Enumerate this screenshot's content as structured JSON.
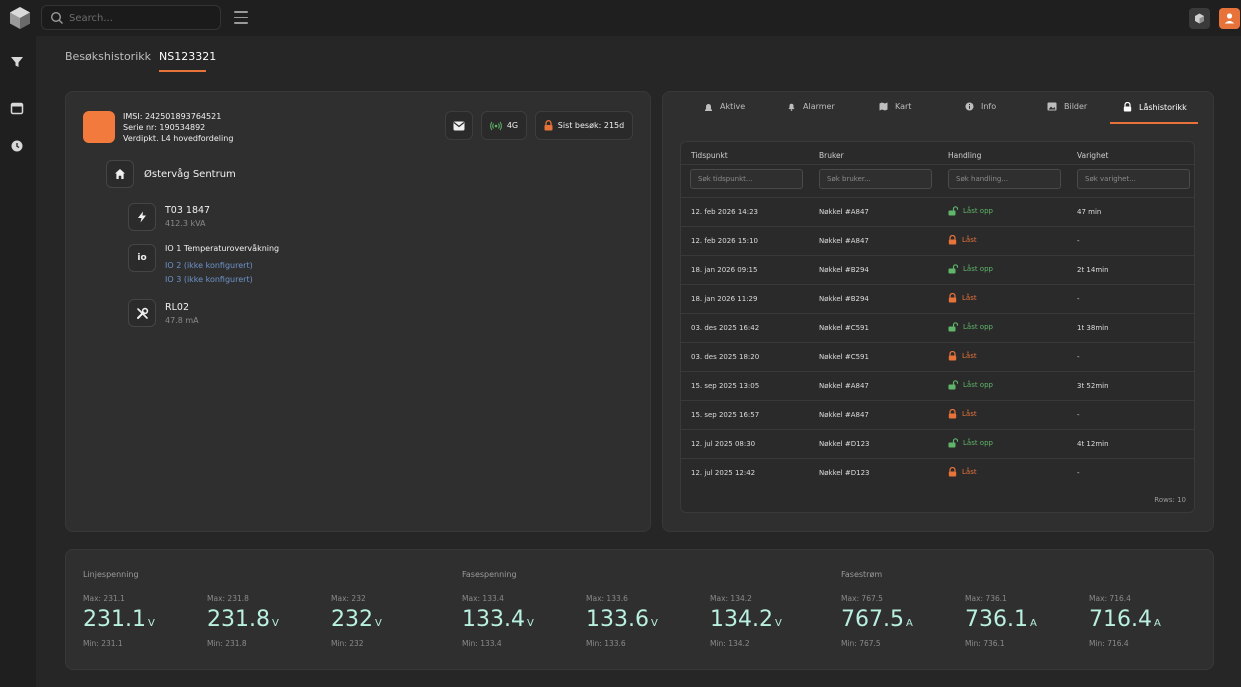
{
  "topbar": {
    "search_placeholder": "Search...",
    "logo_icon": "cube-logo-icon",
    "right_buttons": [
      "cube-icon",
      "user-icon"
    ]
  },
  "rail": {
    "icons": [
      "filter-icon",
      "calendar-icon",
      "clock-icon"
    ]
  },
  "tabs": [
    {
      "label": "Besøkshistorikk",
      "active": false
    },
    {
      "label": "NS123321",
      "active": true
    }
  ],
  "device": {
    "imsi": "IMSI: 242501893764521",
    "serial": "Serie nr: 190534892",
    "verdipkt": "Verdipkt. L4 hovedfordeling",
    "network": "4G",
    "last_visit": "Sist besøk: 215d",
    "location": "Østervåg Sentrum",
    "items": [
      {
        "title": "T03 1847",
        "sub": "412.3 kVA",
        "icon": "bolt-icon"
      },
      {
        "title": "IO 1 Temperaturovervåkning",
        "links": [
          "IO 2 (ikke konfigurert)",
          "IO 3 (ikke konfigurert)"
        ],
        "icon": "io"
      },
      {
        "title": "RL02",
        "sub": "47.8 mA",
        "icon": "tools-icon"
      }
    ]
  },
  "right_tabs": [
    {
      "label": "Aktive",
      "icon": "siren-icon",
      "active": false
    },
    {
      "label": "Alarmer",
      "icon": "bell-icon",
      "active": false
    },
    {
      "label": "Kart",
      "icon": "map-icon",
      "active": false
    },
    {
      "label": "Info",
      "icon": "info-icon",
      "active": false
    },
    {
      "label": "Bilder",
      "icon": "image-icon",
      "active": false
    },
    {
      "label": "Låshistorikk",
      "icon": "lock-icon",
      "active": true
    }
  ],
  "lock_table": {
    "headers": [
      "Tidspunkt",
      "Bruker",
      "Handling",
      "Varighet"
    ],
    "filters": [
      "Søk tidspunkt...",
      "Søk bruker...",
      "Søk handling...",
      "Søk varighet..."
    ],
    "rows": [
      {
        "time": "12. feb 2026 14:23",
        "user": "Nøkkel #A847",
        "action": "Låst opp",
        "state": "open",
        "duration": "47 min"
      },
      {
        "time": "12. feb 2026 15:10",
        "user": "Nøkkel #A847",
        "action": "Låst",
        "state": "locked",
        "duration": "-"
      },
      {
        "time": "18. jan 2026 09:15",
        "user": "Nøkkel #B294",
        "action": "Låst opp",
        "state": "open",
        "duration": "2t 14min"
      },
      {
        "time": "18. jan 2026 11:29",
        "user": "Nøkkel #B294",
        "action": "Låst",
        "state": "locked",
        "duration": "-"
      },
      {
        "time": "03. des 2025 16:42",
        "user": "Nøkkel #C591",
        "action": "Låst opp",
        "state": "open",
        "duration": "1t 38min"
      },
      {
        "time": "03. des 2025 18:20",
        "user": "Nøkkel #C591",
        "action": "Låst",
        "state": "locked",
        "duration": "-"
      },
      {
        "time": "15. sep 2025 13:05",
        "user": "Nøkkel #A847",
        "action": "Låst opp",
        "state": "open",
        "duration": "3t 52min"
      },
      {
        "time": "15. sep 2025 16:57",
        "user": "Nøkkel #A847",
        "action": "Låst",
        "state": "locked",
        "duration": "-"
      },
      {
        "time": "12. jul 2025 08:30",
        "user": "Nøkkel #D123",
        "action": "Låst opp",
        "state": "open",
        "duration": "4t 12min"
      },
      {
        "time": "12. jul 2025 12:42",
        "user": "Nøkkel #D123",
        "action": "Låst",
        "state": "locked",
        "duration": "-"
      }
    ],
    "footer": "Rows: 10"
  },
  "metrics": {
    "groups": [
      {
        "label": "Linjespenning"
      },
      {
        "label": "Fasespenning"
      },
      {
        "label": "Fasestrøm"
      }
    ],
    "values": [
      {
        "max": "Max: 231.1",
        "value": "231.1",
        "unit": "V",
        "min": "Min: 231.1"
      },
      {
        "max": "Max: 231.8",
        "value": "231.8",
        "unit": "V",
        "min": "Min: 231.8"
      },
      {
        "max": "Max: 232",
        "value": "232",
        "unit": "V",
        "min": "Min: 232"
      },
      {
        "max": "Max: 133.4",
        "value": "133.4",
        "unit": "V",
        "min": "Min: 133.4"
      },
      {
        "max": "Max: 133.6",
        "value": "133.6",
        "unit": "V",
        "min": "Min: 133.6"
      },
      {
        "max": "Max: 134.2",
        "value": "134.2",
        "unit": "V",
        "min": "Min: 134.2"
      },
      {
        "max": "Max: 767.5",
        "value": "767.5",
        "unit": "A",
        "min": "Min: 767.5"
      },
      {
        "max": "Max: 736.1",
        "value": "736.1",
        "unit": "A",
        "min": "Min: 736.1"
      },
      {
        "max": "Max: 716.4",
        "value": "716.4",
        "unit": "A",
        "min": "Min: 716.4"
      }
    ]
  },
  "colors": {
    "accent": "#e8733a",
    "open": "#5fb56a",
    "value": "#b9f0e0",
    "link": "#6d93c8"
  }
}
